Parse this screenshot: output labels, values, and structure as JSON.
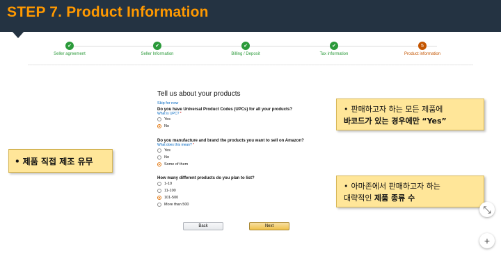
{
  "header": {
    "title": "STEP 7. Product Information"
  },
  "steps": [
    {
      "label": "Seller agreement",
      "state": "done"
    },
    {
      "label": "Seller Information",
      "state": "done"
    },
    {
      "label": "Billing / Deposit",
      "state": "done"
    },
    {
      "label": "Tax information",
      "state": "done"
    },
    {
      "label": "Product information",
      "state": "current",
      "number": "5"
    }
  ],
  "form": {
    "title": "Tell us about your products",
    "skip": "Skip for now",
    "q1": {
      "text": "Do you have Universal Product Codes (UPCs) for all your products?",
      "help": "What is UPC?",
      "req": "*",
      "options": [
        "Yes",
        "No"
      ],
      "selected": "No"
    },
    "q2": {
      "text": "Do you manufacture and brand the products you want to sell on Amazon?",
      "help": "What does this mean?",
      "req": "*",
      "options": [
        "Yes",
        "No",
        "Some of them"
      ],
      "selected": "Some of them"
    },
    "q3": {
      "text": "How many different products do you plan to list?",
      "options": [
        "1-10",
        "11-100",
        "101-500",
        "More than 500"
      ],
      "selected": "101-500"
    },
    "back": "Back",
    "next": "Next"
  },
  "callouts": {
    "c1": {
      "bullet": "•",
      "line1": "판매하고자 하는 모든 제품에",
      "line2_bold": "바코드가 있는 경우에만",
      "line2_quote": "“Yes”"
    },
    "c2": {
      "bullet": "•",
      "text": "제품 직접 제조 유무"
    },
    "c3": {
      "bullet": "•",
      "line1": "아마존에서 판매하고자 하는",
      "line2_normal": "대략적인",
      "line2_bold": "제품 종류 수"
    }
  },
  "side": {
    "collapse": "⤡",
    "plus": "+"
  },
  "colors": {
    "header_bg": "#243342",
    "accent": "#ff9900",
    "done": "#2b9a3a",
    "current": "#c45500",
    "callout": "#ffe699"
  }
}
